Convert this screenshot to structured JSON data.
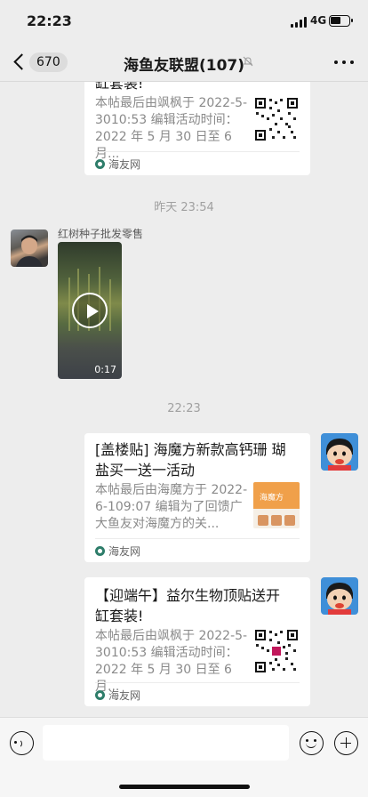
{
  "status_bar": {
    "time": "22:23",
    "network": "4G"
  },
  "nav": {
    "unread_count": "670",
    "title": "海鱼友联盟(107)"
  },
  "messages": [
    {
      "type": "link_card",
      "title_tail": "缸套装!",
      "description": "本帖最后由飒枫于 2022-5-3010:53 编辑活动时间：2022 年 5 月 30 日至 6 月...",
      "source": "海友网"
    },
    {
      "type": "timestamp",
      "text": "昨天 23:54"
    },
    {
      "type": "video",
      "sender": "红树种子批发零售",
      "duration": "0:17"
    },
    {
      "type": "timestamp",
      "text": "22:23"
    },
    {
      "type": "link_card",
      "title_line1": "[盖楼贴] 海魔方新款高钙珊 瑚",
      "title_line2": "盐买一送一活动",
      "description": "本帖最后由海魔方于 2022-6-109:07 编辑为了回馈广大鱼友对海魔方的关...",
      "source": "海友网",
      "thumb_text": "海魔方"
    },
    {
      "type": "link_card",
      "title_line1": "【迎端午】益尔生物顶贴送开",
      "title_line2": "缸套装!",
      "description": "本帖最后由飒枫于 2022-5-3010:53 编辑活动时间：2022 年 5 月 30 日至 6 月...",
      "source": "海友网"
    }
  ],
  "colors": {
    "background": "#ededed",
    "card": "#ffffff",
    "source_logo": "#2e7d6a"
  }
}
